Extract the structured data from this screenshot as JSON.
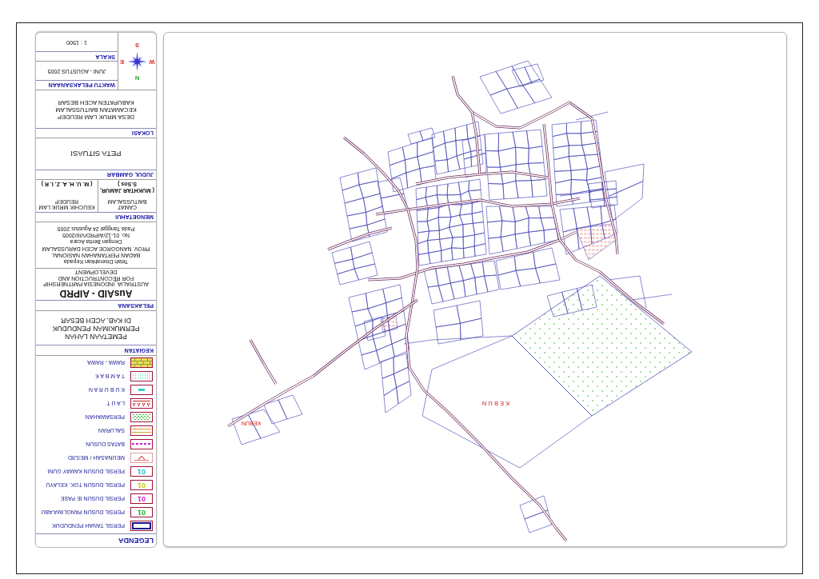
{
  "title_block": {
    "legend": {
      "title": "LEGENDA",
      "items": [
        {
          "label": "PERSIL TANAH PENDUDUK",
          "kind": "outline",
          "color": "#1a1a8c"
        },
        {
          "label": "PERSIL DUSUN PANGLIMA ABU",
          "kind": "number",
          "sample": "01",
          "color": "#22aa22"
        },
        {
          "label": "PERSIL DUSUN IE PASE",
          "kind": "number",
          "sample": "01",
          "color": "#cc22cc"
        },
        {
          "label": "PERSIL DUSUN TGK. KELAYU",
          "kind": "number",
          "sample": "01",
          "color": "#c8c800"
        },
        {
          "label": "PERSIL DUSUN KAMAY GUNI",
          "kind": "number",
          "sample": "01",
          "color": "#22bbcc"
        },
        {
          "label": "MEUNASAH / MESJID",
          "kind": "symbol",
          "color": "#e07070"
        },
        {
          "label": "BATAS DUSUN",
          "kind": "dashed",
          "color": "#cc22cc"
        },
        {
          "label": "SALURAN",
          "kind": "double-line",
          "color": "#d4a020"
        },
        {
          "label": "PERSAWAHAN",
          "kind": "dots",
          "color": "#33bb33"
        },
        {
          "label": "L A U T",
          "kind": "waves",
          "color": "#cc2222"
        },
        {
          "label": "K U B U R A N",
          "kind": "patch",
          "color": "#33cccc"
        },
        {
          "label": "T A M B A K",
          "kind": "dotted",
          "color": "#66cccc"
        },
        {
          "label": "RAWA - RAWA",
          "kind": "brick",
          "color": "#e8e060"
        }
      ]
    },
    "activity": {
      "header": "KEGIATAN",
      "lines": [
        "PEMETAAN LAHAN",
        "PERMUKIMAN PENDUDUK",
        "DI KAB. ACEH BESAR"
      ]
    },
    "executor": {
      "header": "PELAKSANA",
      "name": "AusAID - AIPRD",
      "description": [
        "AUSTRALIA_INDONESIA PARTNERSHIP",
        "FOR RECONTRUCTION AND",
        "DEVELOPMENT"
      ],
      "handover": [
        "Telah Diserahkan Kepada",
        "BADAN PERTANAHAN NASIONAL",
        "PROV. NANGGROE ACEH DARUSSALAM",
        "Dengan Berita Acara",
        "No. 01-12/AIPRD/VIII/2005",
        "Pada Tanggal 24 Agustus 2005"
      ]
    },
    "acknowledged": {
      "header": "MENGETAHUI",
      "signatories": [
        {
          "title": "CAMAT BAITUSSALAM",
          "name": "( MUKHTAR JAMUR, S.Sos )"
        },
        {
          "title": "KEUCHIK MRUK LAM REUDEP",
          "name": "( M. U. H. A. Z. I. R )"
        }
      ]
    },
    "drawing_title": {
      "header": "JUDUL GAMBAR",
      "text": "PETA SITUASI"
    },
    "location": {
      "header": "LOKASI",
      "lines": [
        "DESA MRUK LAM REUDEP",
        "KECAMATAN BAITUSSALAM",
        "KABUPATEN ACEH BESAR"
      ]
    },
    "compass": {
      "north": "N",
      "east": "E",
      "south": "S",
      "west": "W"
    },
    "schedule": {
      "header": "WAKTU PELAKSANAAN",
      "text": "JUNI - AGUSTUS 2005"
    },
    "scale": {
      "header": "SKALA",
      "text": "1 : 1500"
    }
  },
  "map": {
    "labels": [
      {
        "text": "K E B U N"
      },
      {
        "text": "KEBUN"
      }
    ]
  }
}
